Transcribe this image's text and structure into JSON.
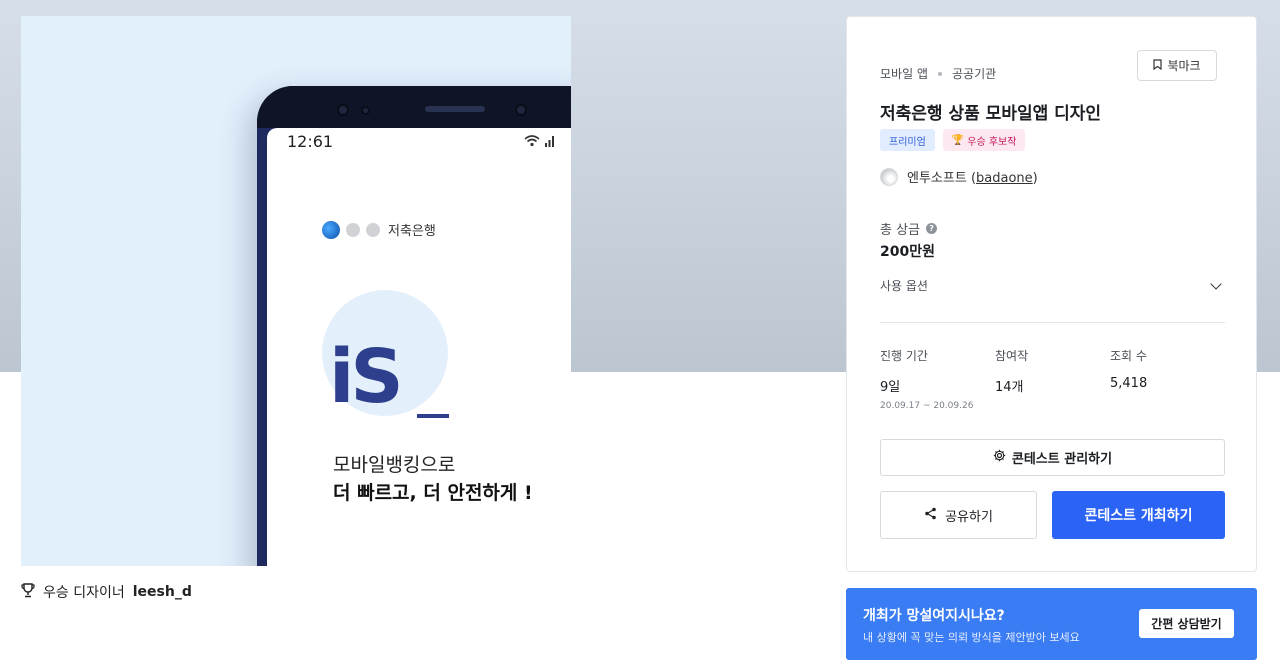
{
  "hero": {
    "phone_time": "12:61",
    "bank_name": "저축은행",
    "logo_text": "iS",
    "slogan_line1": "모바일뱅킹으로",
    "slogan_line2": "더 빠르고, 더 안전하게 !"
  },
  "caption": {
    "icon": "trophy-icon",
    "prefix": "우승 디자이너",
    "designer": "leesh_d"
  },
  "card": {
    "breadcrumb": [
      "모바일 앱",
      "공공기관"
    ],
    "bookmark_label": "북마크",
    "title": "저축은행 상품 모바일앱 디자인",
    "badges": {
      "premium": "프리미엄",
      "winner": "우승 후보작"
    },
    "author": {
      "company": "엔투소프트",
      "handle": "badaone"
    },
    "prize": {
      "label": "총 상금",
      "value": "200만원"
    },
    "options_label": "사용 옵션",
    "stats": [
      {
        "label": "진행 기간",
        "value": "9일",
        "sub": "20.09.17 ~ 20.09.26"
      },
      {
        "label": "참여작",
        "value": "14개",
        "sub": ""
      },
      {
        "label": "조회 수",
        "value": "5,418",
        "sub": ""
      }
    ],
    "manage_label": "콘테스트 관리하기",
    "share_label": "공유하기",
    "host_label": "콘테스트 개최하기",
    "accent_color": "#2b63f5"
  },
  "promo": {
    "title": "개최가 망설여지시나요?",
    "subtitle": "내 상황에 꼭 맞는 의뢰 방식을 제안받아 보세요",
    "button_label": "간편 상담받기",
    "color": "#3a7cf3"
  }
}
